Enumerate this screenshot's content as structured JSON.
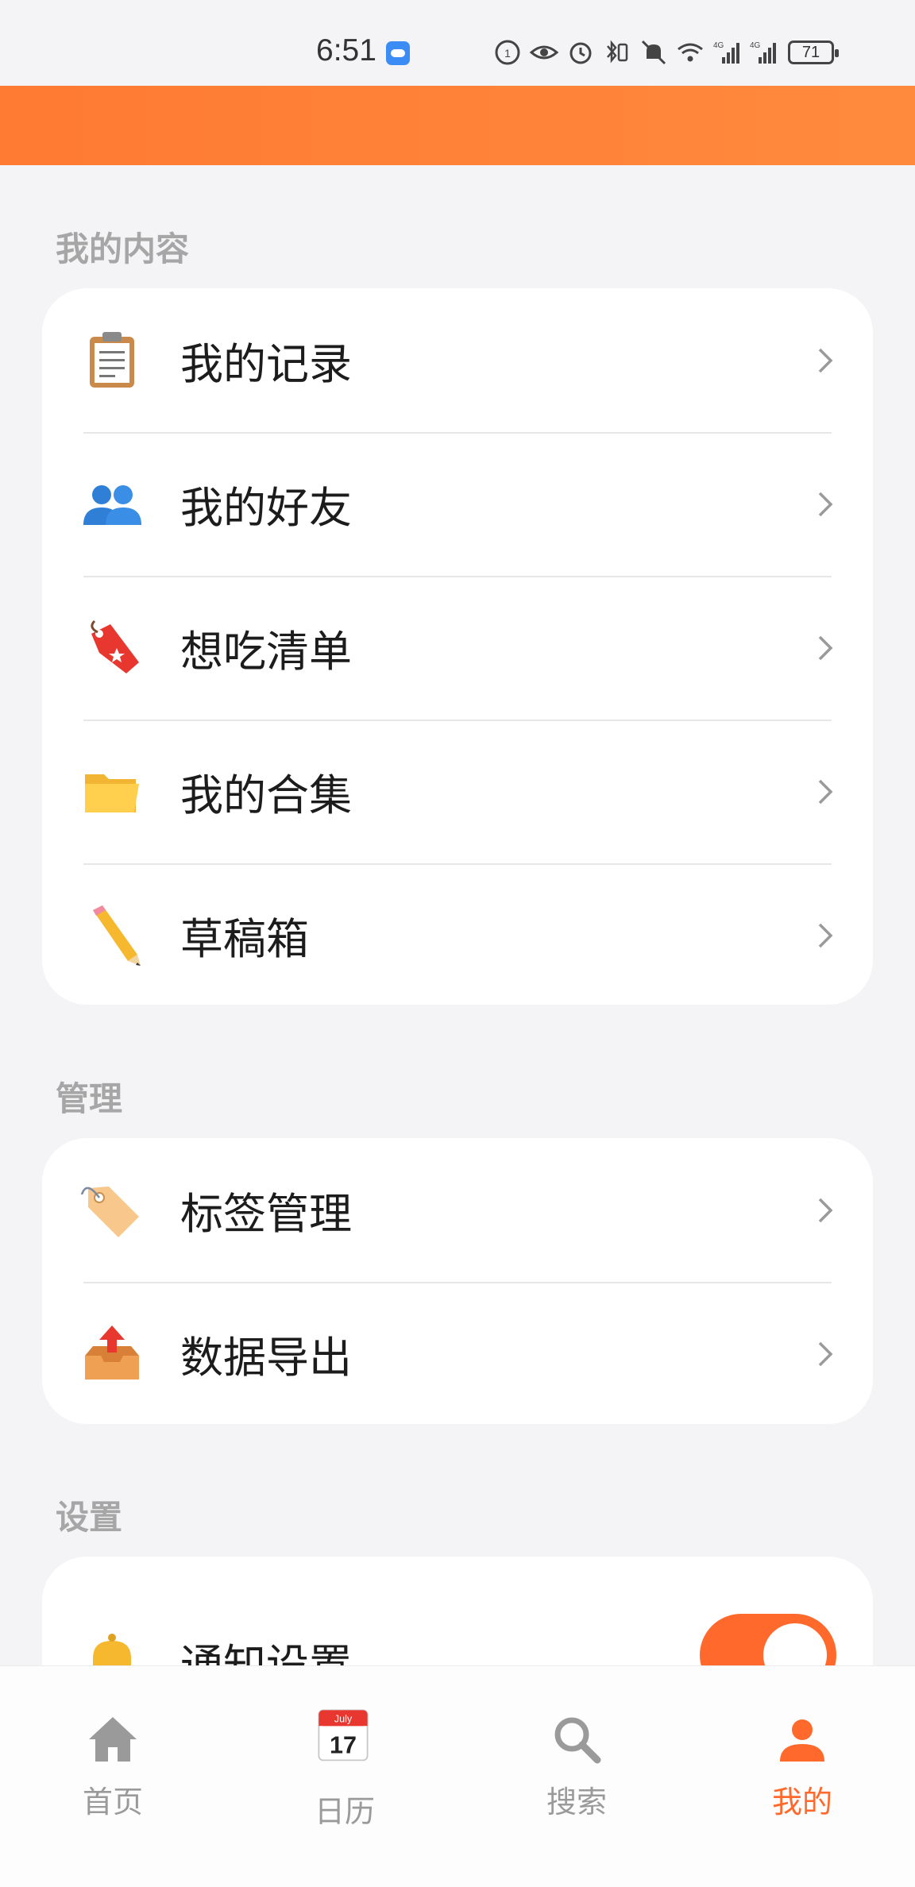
{
  "status_bar": {
    "time": "6:51",
    "battery": "71",
    "icons": [
      "data-saver-icon",
      "eye-icon",
      "alarm-icon",
      "bluetooth-battery-icon",
      "mute-icon",
      "wifi-icon",
      "signal-4g-icon",
      "signal-4g-icon"
    ]
  },
  "sections": {
    "content": {
      "title": "我的内容",
      "items": [
        {
          "label": "我的记录",
          "icon": "clipboard-icon"
        },
        {
          "label": "我的好友",
          "icon": "friends-icon"
        },
        {
          "label": "想吃清单",
          "icon": "bookmark-tag-icon"
        },
        {
          "label": "我的合集",
          "icon": "folder-icon"
        },
        {
          "label": "草稿箱",
          "icon": "pencil-icon"
        }
      ]
    },
    "manage": {
      "title": "管理",
      "items": [
        {
          "label": "标签管理",
          "icon": "tag-icon"
        },
        {
          "label": "数据导出",
          "icon": "export-tray-icon"
        }
      ]
    },
    "settings": {
      "title": "设置",
      "items": [
        {
          "label": "通知设置",
          "icon": "bell-icon",
          "toggle": true
        }
      ]
    }
  },
  "bottom_nav": {
    "items": [
      {
        "label": "首页",
        "icon": "home-icon",
        "active": false
      },
      {
        "label": "日历",
        "icon": "calendar-icon",
        "active": false,
        "calendar_month": "July",
        "calendar_day": "17"
      },
      {
        "label": "搜索",
        "icon": "search-icon",
        "active": false
      },
      {
        "label": "我的",
        "icon": "profile-icon",
        "active": true
      }
    ]
  },
  "colors": {
    "accent": "#ff6a2c",
    "header": "#ff7a33",
    "background": "#f4f4f6"
  }
}
